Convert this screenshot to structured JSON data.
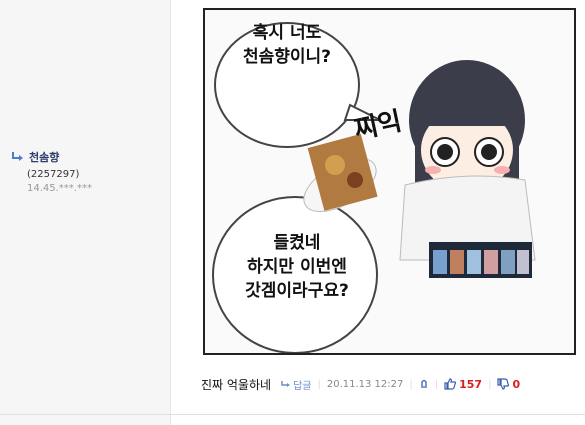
{
  "author": {
    "name": "천솜향",
    "user_id": "(2257297)",
    "ip": "14.45.***.***"
  },
  "comic": {
    "bubble_top": "혹시 너도\n천솜향이니?",
    "sfx": "찌익",
    "bubble_bottom": "들켰네\n하지만 이번엔\n갓겜이라구요?"
  },
  "comment": {
    "text": "진짜 억울하네",
    "reply_label": "답글",
    "date": "20.11.13 12:27",
    "like_count": "157",
    "dislike_count": "0"
  },
  "colors": {
    "accent": "#3a5db0",
    "vote": "#d62020"
  },
  "icons": {
    "reply": "reply-arrow-icon",
    "report": "report-icon",
    "like": "thumbs-up-icon",
    "dislike": "thumbs-down-icon"
  }
}
